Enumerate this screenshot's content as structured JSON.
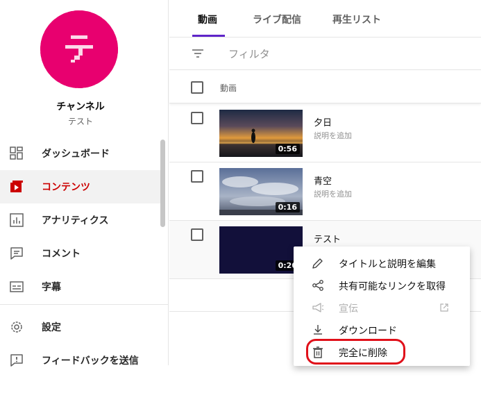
{
  "channel": {
    "name": "チャンネル",
    "subtitle": "テスト",
    "avatar_letter": "テ",
    "avatar_color": "#e8006f"
  },
  "sidebar": {
    "items": [
      {
        "label": "ダッシュボード",
        "icon": "dashboard-icon",
        "active": false
      },
      {
        "label": "コンテンツ",
        "icon": "content-icon",
        "active": true
      },
      {
        "label": "アナリティクス",
        "icon": "analytics-icon",
        "active": false
      },
      {
        "label": "コメント",
        "icon": "comment-icon",
        "active": false
      },
      {
        "label": "字幕",
        "icon": "subtitles-icon",
        "active": false
      },
      {
        "label": "設定",
        "icon": "settings-icon",
        "active": false
      },
      {
        "label": "フィードバックを送信",
        "icon": "feedback-icon",
        "active": false
      }
    ]
  },
  "tabs": [
    {
      "label": "動画",
      "active": true
    },
    {
      "label": "ライブ配信",
      "active": false
    },
    {
      "label": "再生リスト",
      "active": false
    }
  ],
  "filter": {
    "placeholder": "フィルタ"
  },
  "table": {
    "column_video": "動画",
    "rows": [
      {
        "title": "夕日",
        "description": "説明を追加",
        "duration": "0:56"
      },
      {
        "title": "青空",
        "description": "説明を追加",
        "duration": "0:16"
      },
      {
        "title": "テスト",
        "description": "",
        "duration": "0:20"
      }
    ]
  },
  "context_menu": {
    "items": [
      {
        "label": "タイトルと説明を編集",
        "icon": "pencil-icon",
        "disabled": false
      },
      {
        "label": "共有可能なリンクを取得",
        "icon": "share-icon",
        "disabled": false
      },
      {
        "label": "宣伝",
        "icon": "megaphone-icon",
        "disabled": true
      },
      {
        "label": "ダウンロード",
        "icon": "download-icon",
        "disabled": false
      },
      {
        "label": "完全に削除",
        "icon": "trash-icon",
        "disabled": false,
        "highlighted": true
      }
    ]
  },
  "colors": {
    "accent_red": "#cc0000",
    "tab_underline": "#5f25c9",
    "highlight_ring": "#e0101a"
  }
}
